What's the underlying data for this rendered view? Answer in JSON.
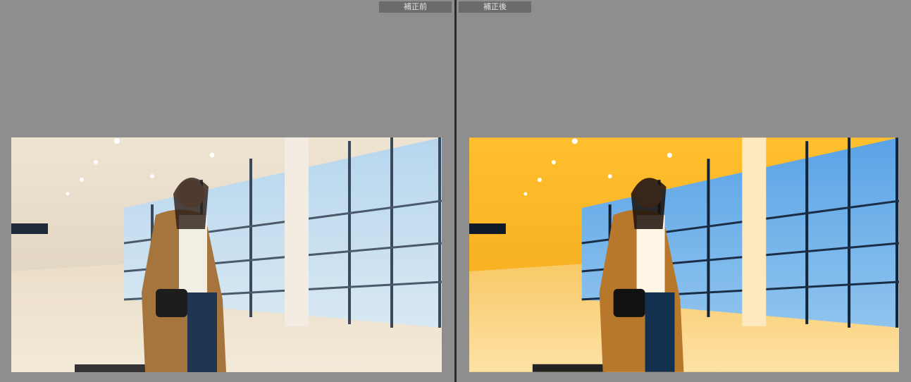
{
  "compare": {
    "before_label": "補正前",
    "after_label": "補正後"
  },
  "colors": {
    "background": "#8e8e8e",
    "label_bg": "#6b6b6b",
    "before_ceiling": "#efe6d6",
    "after_ceiling": "#ffbf2e"
  }
}
